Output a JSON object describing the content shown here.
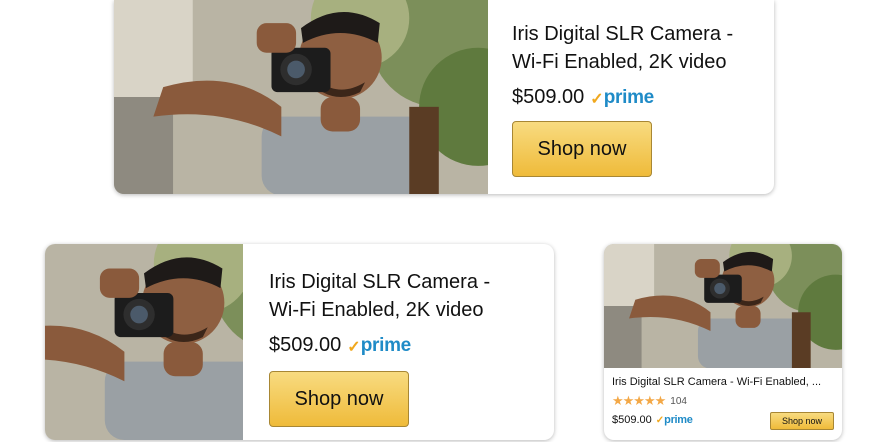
{
  "product": {
    "title": "Iris Digital SLR Camera - Wi-Fi Enabled, 2K video",
    "title_line1": "Iris Digital SLR Camera -",
    "title_line2": "Wi-Fi Enabled, 2K video",
    "title_truncated": "Iris Digital SLR Camera - Wi-Fi Enabled, ...",
    "price": "$509.00",
    "prime_check": "✓",
    "prime_label": "prime",
    "rating_stars": "★★★★★",
    "review_count": "104",
    "cta_label": "Shop now"
  },
  "colors": {
    "button_top": "#f8db80",
    "button_bottom": "#efbb3a",
    "prime_blue": "#1f8bc7",
    "prime_check": "#f0a81e",
    "stars": "#f3a847"
  },
  "icons": [
    "camera-photo",
    "prime-check-icon",
    "star-icon"
  ]
}
